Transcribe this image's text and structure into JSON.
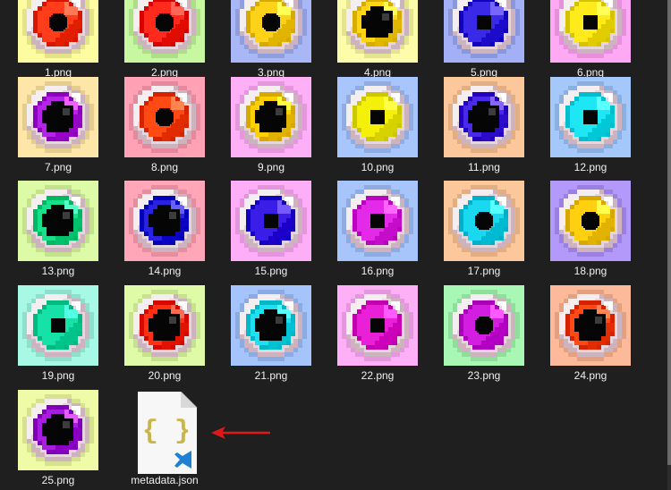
{
  "files": [
    {
      "name": "1.png",
      "bg": "#fdfca0",
      "iris": "#ff3d1a",
      "pupil": "cross"
    },
    {
      "name": "2.png",
      "bg": "#c8f7a2",
      "iris": "#ff2a1c",
      "pupil": "cross"
    },
    {
      "name": "3.png",
      "bg": "#a9b7f7",
      "iris": "#ffd21a",
      "pupil": "cross"
    },
    {
      "name": "4.png",
      "bg": "#fdfca8",
      "iris": "#ffd514",
      "pupil": "round"
    },
    {
      "name": "5.png",
      "bg": "#a4b0f6",
      "iris": "#3a2ae8",
      "pupil": "square"
    },
    {
      "name": "6.png",
      "bg": "#ffa9f4",
      "iris": "#ffea1c",
      "pupil": "square"
    },
    {
      "name": "7.png",
      "bg": "#fde6a8",
      "iris": "#b423e6",
      "pupil": "round"
    },
    {
      "name": "8.png",
      "bg": "#ffa2b5",
      "iris": "#ff4a14",
      "pupil": "cross"
    },
    {
      "name": "9.png",
      "bg": "#fdb0f5",
      "iris": "#ffd000",
      "pupil": "round"
    },
    {
      "name": "10.png",
      "bg": "#a8c6fb",
      "iris": "#f4f00a",
      "pupil": "square"
    },
    {
      "name": "11.png",
      "bg": "#fcc79a",
      "iris": "#4a2ae8",
      "pupil": "round"
    },
    {
      "name": "12.png",
      "bg": "#a5c8fb",
      "iris": "#1ee6f5",
      "pupil": "square"
    },
    {
      "name": "13.png",
      "bg": "#ddfba6",
      "iris": "#18e08a",
      "pupil": "round"
    },
    {
      "name": "14.png",
      "bg": "#ffa7b8",
      "iris": "#2a22e0",
      "pupil": "round"
    },
    {
      "name": "15.png",
      "bg": "#fdaef6",
      "iris": "#3a1ee8",
      "pupil": "square"
    },
    {
      "name": "16.png",
      "bg": "#a7c4fb",
      "iris": "#e22ae8",
      "pupil": "square"
    },
    {
      "name": "17.png",
      "bg": "#fcc79a",
      "iris": "#1ad8f0",
      "pupil": "cross"
    },
    {
      "name": "18.png",
      "bg": "#b39afa",
      "iris": "#ffd010",
      "pupil": "cross"
    },
    {
      "name": "19.png",
      "bg": "#a7f8e4",
      "iris": "#16e2a8",
      "pupil": "square"
    },
    {
      "name": "20.png",
      "bg": "#dffba8",
      "iris": "#ff3014",
      "pupil": "round"
    },
    {
      "name": "21.png",
      "bg": "#a5c4fb",
      "iris": "#1ee0f0",
      "pupil": "round"
    },
    {
      "name": "22.png",
      "bg": "#fdb0f6",
      "iris": "#ea20d8",
      "pupil": "square"
    },
    {
      "name": "23.png",
      "bg": "#a9f7b4",
      "iris": "#d21ee0",
      "pupil": "cross"
    },
    {
      "name": "24.png",
      "bg": "#fcba9a",
      "iris": "#ff4a14",
      "pupil": "round"
    },
    {
      "name": "25.png",
      "bg": "#effba6",
      "iris": "#a81ee0",
      "pupil": "round"
    }
  ],
  "json_file": {
    "name": "metadata.json",
    "icon": "vscode-json-file-icon",
    "braces_color": "#c9b64a",
    "badge_color": "#1f7fd4"
  },
  "annotation": {
    "icon": "left-arrow-icon",
    "color": "#e01818"
  }
}
